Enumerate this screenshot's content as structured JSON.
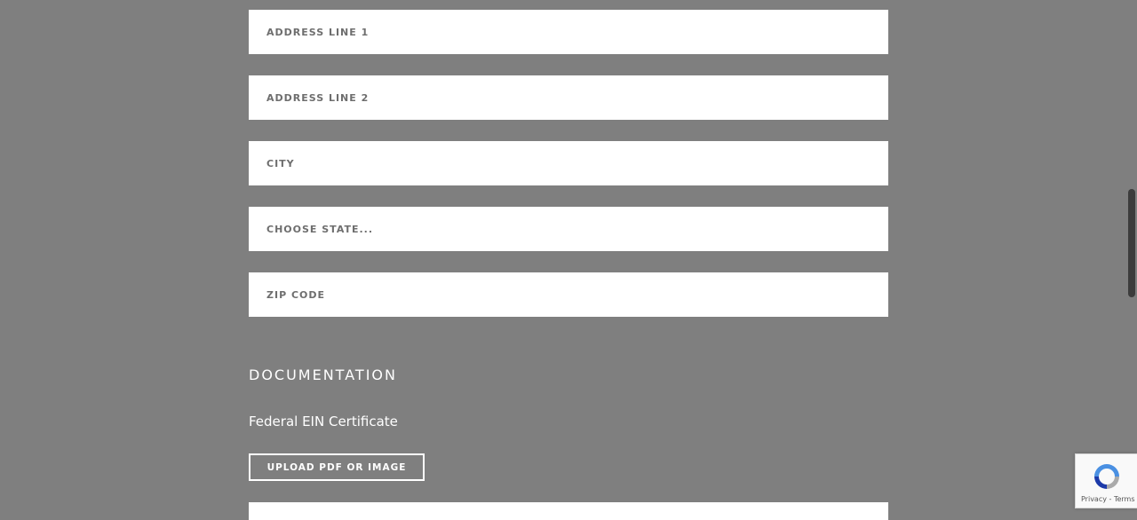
{
  "address_form": {
    "address_line_1": {
      "placeholder": "ADDRESS LINE 1"
    },
    "address_line_2": {
      "placeholder": "ADDRESS LINE 2"
    },
    "city": {
      "placeholder": "CITY"
    },
    "state": {
      "selected": "CHOOSE STATE..."
    },
    "zip": {
      "placeholder": "ZIP CODE"
    }
  },
  "documentation": {
    "heading": "DOCUMENTATION",
    "federal_ein_label": "Federal EIN Certificate",
    "upload_button": "UPLOAD PDF OR IMAGE"
  },
  "recaptcha": {
    "links": "Privacy - Terms"
  },
  "colors": {
    "background": "#7f7f7f",
    "field_background": "#ffffff",
    "text_light": "#ffffff",
    "placeholder_text": "#6e6e6e"
  }
}
